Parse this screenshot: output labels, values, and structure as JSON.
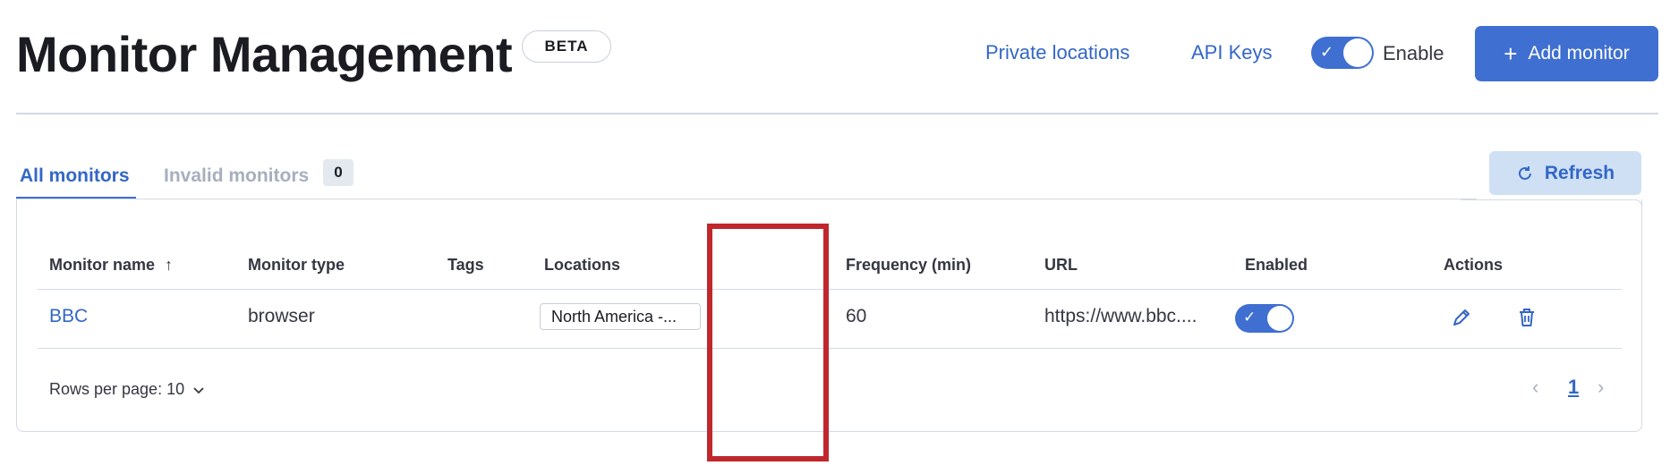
{
  "header": {
    "title": "Monitor Management",
    "badge": "BETA",
    "links": {
      "private_locations": "Private locations",
      "api_keys": "API Keys"
    },
    "enable_toggle": {
      "label": "Enable",
      "on": true
    },
    "add_button": "Add monitor"
  },
  "tabs": [
    {
      "label": "All monitors",
      "active": true
    },
    {
      "label": "Invalid monitors",
      "count": "0",
      "active": false
    }
  ],
  "refresh_button": "Refresh",
  "table": {
    "columns": [
      "Monitor name",
      "Monitor type",
      "Tags",
      "Locations",
      "Frequency (min)",
      "URL",
      "Enabled",
      "Actions"
    ],
    "sort_icon": "arrow-up-icon",
    "rows": [
      {
        "name": "BBC",
        "type": "browser",
        "tags": "",
        "location": "North America -...",
        "frequency": "60",
        "url": "https://www.bbc....",
        "enabled": true
      }
    ]
  },
  "pagination": {
    "rows_per_page": "Rows per page: 10",
    "current_page": "1"
  },
  "colors": {
    "accent": "#3f6fd1",
    "link": "#3367c6",
    "highlight": "#c0272d",
    "refresh_bg": "#cfe0f4"
  }
}
